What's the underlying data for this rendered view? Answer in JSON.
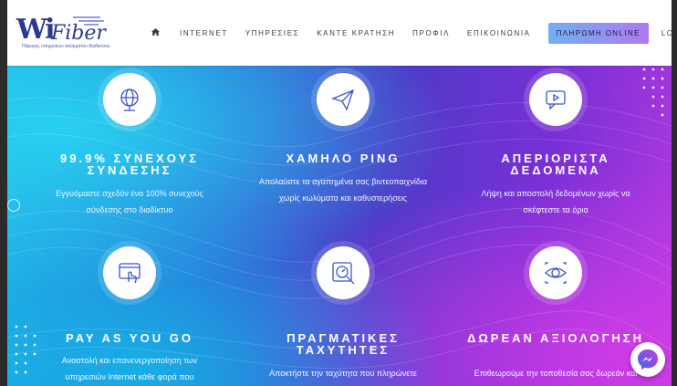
{
  "header": {
    "logo": {
      "brand_mark": "Wi",
      "brand_text": "Fiber",
      "tagline": "Πάροχος υπηρεσιών ασύρματου διαδικτύου"
    },
    "nav": [
      {
        "label": "INTERNET"
      },
      {
        "label": "ΥΠΗΡΕΣΙΕΣ"
      },
      {
        "label": "ΚΑΝΤΕ ΚΡΑΤΗΣΗ"
      },
      {
        "label": "ΠΡΟΦΙΛ"
      },
      {
        "label": "ΕΠΙΚΟΙΝΩΝΙΑ"
      },
      {
        "label": "ΠΛΗΡΩΜΗ ONLINE"
      },
      {
        "label": "LOG IN"
      }
    ],
    "home_icon": "home-icon",
    "language_icon": "greek-flag-icon"
  },
  "features": [
    {
      "icon": "globe-icon",
      "title": "99.9% ΣΥΝΕΧΟΥΣ ΣΥΝΔΕΣΗΣ",
      "desc_line1": "Εγγυόμαστε σχεδόν ένα 100% συνεχούς",
      "desc_line2": "σύνδεσης στο διαδίκτυο"
    },
    {
      "icon": "paper-plane-icon",
      "title": "ΧΑΜΗΛΟ PING",
      "desc_line1": "Απολαύστε τα αγαπημένα σας βιντεοπαιχνίδια",
      "desc_line2": "χωρίς κωλύματα και καθυστερήσεις"
    },
    {
      "icon": "video-chat-icon",
      "title": "ΑΠΕΡΙΟΡΙΣΤΑ ΔΕΔΟΜΕΝΑ",
      "desc_line1": "Λήψη και αποστολή δεδομένων χωρίς να",
      "desc_line2": "σκέφτεστε τα όρια"
    },
    {
      "icon": "touch-screen-icon",
      "title": "PAY AS YOU GO",
      "desc_line1": "Αναστολή και επανενεργοποίηση των",
      "desc_line2": "υπηρεσιών Internet κάθε φορά που"
    },
    {
      "icon": "speed-search-icon",
      "title": "ΠΡΑΓΜΑΤΙΚΕΣ ΤΑΧΥΤΗΤΕΣ",
      "desc_line1": "Αποκτήστε την ταχύτητα που πληρώνετε",
      "desc_line2": ""
    },
    {
      "icon": "eye-scan-icon",
      "title": "ΔΩΡΕΑΝ ΑΞΙΟΛΟΓΗΣΗ",
      "desc_line1": "Επιθεωρούμε την τοποθεσία σας δωρεάν και",
      "desc_line2": ""
    }
  ],
  "chat_widget": {
    "icon": "messenger-icon"
  },
  "colors": {
    "accent_start": "#1fb7e6",
    "accent_end": "#b33be0",
    "brand": "#2b3a8f"
  }
}
